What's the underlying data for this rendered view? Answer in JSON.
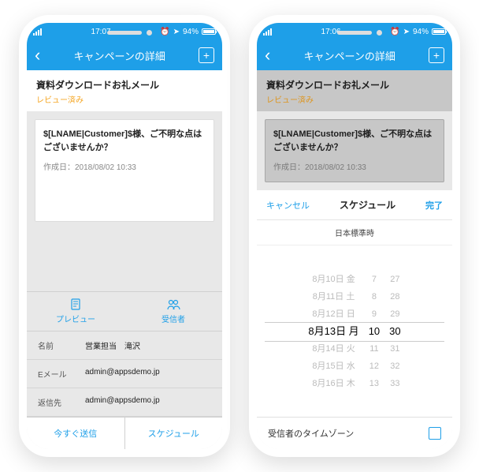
{
  "left": {
    "status": {
      "time": "17:07",
      "battery": "94%"
    },
    "nav": {
      "title": "キャンペーンの詳細"
    },
    "header": {
      "title": "資料ダウンロードお礼メール",
      "status": "レビュー済み"
    },
    "card": {
      "subject": "$[LNAME|Customer]$様、ご不明な点はございませんか？",
      "meta": "作成日：2018/08/02 10:33"
    },
    "tabs": {
      "preview": "プレビュー",
      "recipients": "受信者"
    },
    "rows": {
      "name": {
        "label": "名前",
        "value": "営業担当　滝沢"
      },
      "email": {
        "label": "Eメール",
        "value": "admin@appsdemo.jp"
      },
      "replyto": {
        "label": "返信先",
        "value": "admin@appsdemo.jp"
      }
    },
    "footer": {
      "send": "今すぐ送信",
      "schedule": "スケジュール"
    }
  },
  "right": {
    "status": {
      "time": "17:06",
      "battery": "94%"
    },
    "nav": {
      "title": "キャンペーンの詳細"
    },
    "header": {
      "title": "資料ダウンロードお礼メール",
      "status": "レビュー済み"
    },
    "card": {
      "subject": "$[LNAME|Customer]$様、ご不明な点はございませんか？",
      "meta": "作成日：2018/08/02 10:33"
    },
    "sheet": {
      "cancel": "キャンセル",
      "title": "スケジュール",
      "done": "完了",
      "tz": "日本標準時",
      "dates": [
        "8月10日 金",
        "8月11日 土",
        "8月12日 日",
        "8月13日 月",
        "8月14日 火",
        "8月15日 水",
        "8月16日 木"
      ],
      "hours": [
        "7",
        "8",
        "9",
        "10",
        "11",
        "12",
        "13"
      ],
      "mins": [
        "27",
        "28",
        "29",
        "30",
        "31",
        "32",
        "33"
      ],
      "tzrow": "受信者のタイムゾーン"
    }
  }
}
